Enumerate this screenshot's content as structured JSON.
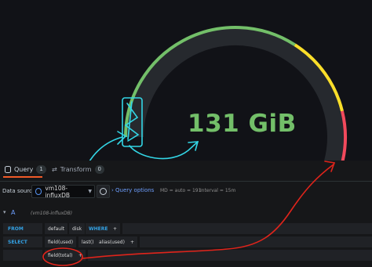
{
  "gauge": {
    "value_text": "131 GiB",
    "fill_fraction": 0.8,
    "colors": {
      "green": "#73bf69",
      "yellow": "#fade2a",
      "red": "#f2495c",
      "track": "#26292e",
      "value": "#73bf69"
    }
  },
  "annotation_colors": {
    "cyan": "#33d6e6",
    "red": "#e0241b"
  },
  "tabs": [
    {
      "label": "Query",
      "count": "1",
      "icon": "database-icon"
    },
    {
      "label": "Transform",
      "count": "0",
      "icon": "transform-icon"
    }
  ],
  "datasource": {
    "label": "Data source",
    "selected": "vm108-influxDB",
    "query_options_label": "Query options",
    "md_text": "MD = auto = 191",
    "interval_text": "Interval = 15m"
  },
  "query": {
    "letter": "A",
    "datasource_hint": "(vm108-influxDB)",
    "from": {
      "keyword": "FROM",
      "policy": "default",
      "measurement": "disk",
      "where_keyword": "WHERE",
      "add": "+"
    },
    "select": {
      "keyword": "SELECT",
      "row1": {
        "field": "field(used)",
        "agg": "last()",
        "alias": "alias(used)",
        "add": "+"
      },
      "row2": {
        "field": "field(total)",
        "add": "+"
      }
    }
  }
}
